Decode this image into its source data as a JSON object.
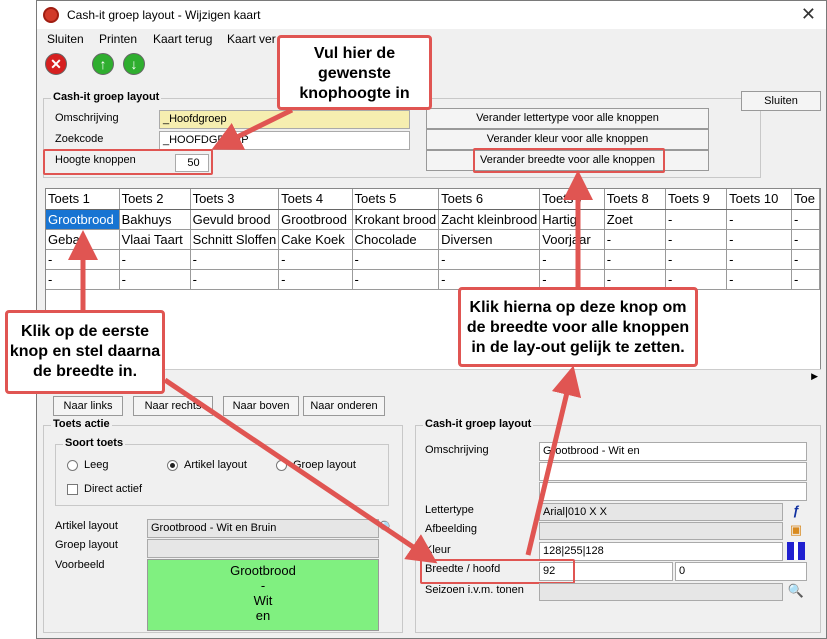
{
  "window": {
    "title": "Cash-it groep layout - Wijzigen kaart"
  },
  "menu": [
    "Sluiten",
    "Printen",
    "Kaart terug",
    "Kaart ver"
  ],
  "top_group": {
    "label": "Cash-it groep layout",
    "omschrijving_label": "Omschrijving",
    "omschrijving_value": "_Hoofdgroep",
    "zoekcode_label": "Zoekcode",
    "zoekcode_value": "_HOOFDGROEP",
    "hoogte_label": "Hoogte knoppen",
    "hoogte_value": "50",
    "btn_lettertype": "Verander lettertype voor alle knoppen",
    "btn_kleur": "Verander kleur voor alle knoppen",
    "btn_breedte": "Verander breedte voor alle knoppen"
  },
  "close_button": "Sluiten",
  "grid": {
    "headers": [
      "Toets 1",
      "Toets 2",
      "Toets 3",
      "Toets 4",
      "Toets 5",
      "Toets 6",
      "Toets 7",
      "Toets 8",
      "Toets 9",
      "Toets 10",
      "Toe"
    ],
    "rows": [
      [
        "Grootbrood",
        "Bakhuys",
        "Gevuld brood",
        "Grootbrood",
        "Krokant brood",
        "Zacht kleinbrood",
        "Hartig",
        "Zoet",
        "-",
        "-",
        "-"
      ],
      [
        "Gebak",
        "Vlaai Taart",
        "Schnitt Sloffen",
        "Cake Koek",
        "Chocolade",
        "Diversen",
        "Voorjaar",
        "-",
        "-",
        "-",
        "-"
      ],
      [
        "-",
        "-",
        "-",
        "-",
        "-",
        "-",
        "-",
        "-",
        "-",
        "-",
        "-"
      ],
      [
        "-",
        "-",
        "-",
        "-",
        "-",
        "-",
        "-",
        "-",
        "-",
        "-",
        "-"
      ]
    ]
  },
  "nav_buttons": [
    "Naar links",
    "Naar rechts",
    "Naar boven",
    "Naar onderen"
  ],
  "toets_actie": {
    "label": "Toets actie",
    "soort_label": "Soort toets",
    "opt_leeg": "Leeg",
    "opt_artikel": "Artikel layout",
    "opt_groep": "Groep layout",
    "direct_actief": "Direct actief",
    "artikel_layout_label": "Artikel layout",
    "artikel_layout_value": "Grootbrood - Wit en Bruin",
    "groep_layout_label": "Groep layout",
    "voorbeeld_label": "Voorbeeld",
    "preview_lines": [
      "Grootbrood",
      "-",
      "Wit",
      "en"
    ]
  },
  "bottom_group": {
    "label": "Cash-it groep layout",
    "omschrijving_label": "Omschrijving",
    "omschrijving_value": "Grootbrood - Wit en",
    "lettertype_label": "Lettertype",
    "lettertype_value": "Arial|010  X  X",
    "afbeelding_label": "Afbeelding",
    "kleur_label": "Kleur",
    "kleur_value": "128|255|128",
    "breedte_label": "Breedte / hoofd",
    "breedte_value": "92",
    "hoofd_value": "0",
    "seizoen_label": "Seizoen i.v.m. tonen"
  },
  "callouts": {
    "hoogte": "Vul hier de gewenste knophoogte in",
    "eerste_knop": "Klik op de eerste knop en stel daarna de breedte in.",
    "breedte_knop": "Klik hierna op deze knop om de breedte voor alle knoppen in de lay-out gelijk te zetten."
  },
  "colors": {
    "accent_red": "#e05552",
    "selection_blue": "#1874d2",
    "preview_green": "#80f080",
    "field_yellow": "#f6eeb0"
  },
  "icons": [
    "app-icon",
    "close-icon",
    "cancel-icon",
    "arrow-up-icon",
    "arrow-down-icon",
    "font-icon",
    "image-icon",
    "color-icon",
    "search-icon"
  ]
}
